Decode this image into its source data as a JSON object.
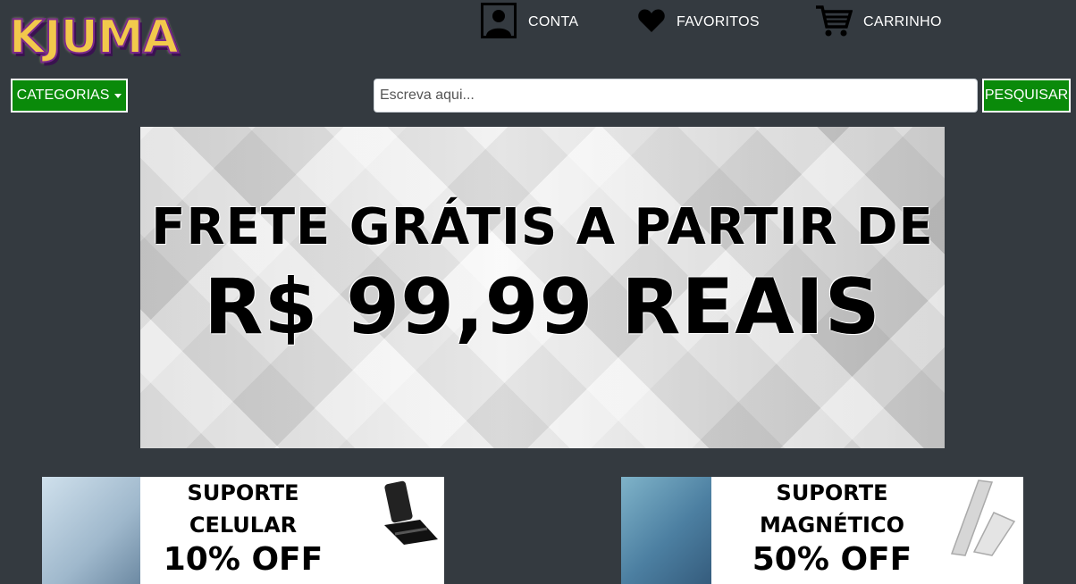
{
  "brand": {
    "logo_text": "KJUMA"
  },
  "header": {
    "account_label": "CONTA",
    "favorites_label": "FAVORITOS",
    "cart_label": "CARRINHO"
  },
  "toolbar": {
    "categories_label": "CATEGORIAS",
    "search_placeholder": "Escreva aqui...",
    "search_button_label": "PESQUISAR"
  },
  "banner": {
    "line1": "FRETE GRÁTIS A PARTIR DE",
    "line2": "R$ 99,99 REAIS"
  },
  "promos": [
    {
      "line1": "SUPORTE",
      "line2": "CELULAR",
      "line3": "10% OFF"
    },
    {
      "line1": "SUPORTE",
      "line2": "MAGNÉTICO",
      "line3": "50% OFF"
    }
  ],
  "icons": {
    "account": "user-icon",
    "favorites": "heart-icon",
    "cart": "cart-icon",
    "categories": "caret-down-icon"
  },
  "colors": {
    "background": "#343a40",
    "button_green": "#0a8a0a",
    "logo_gold": "#f2c94c",
    "logo_purple": "#7b2a8a"
  }
}
